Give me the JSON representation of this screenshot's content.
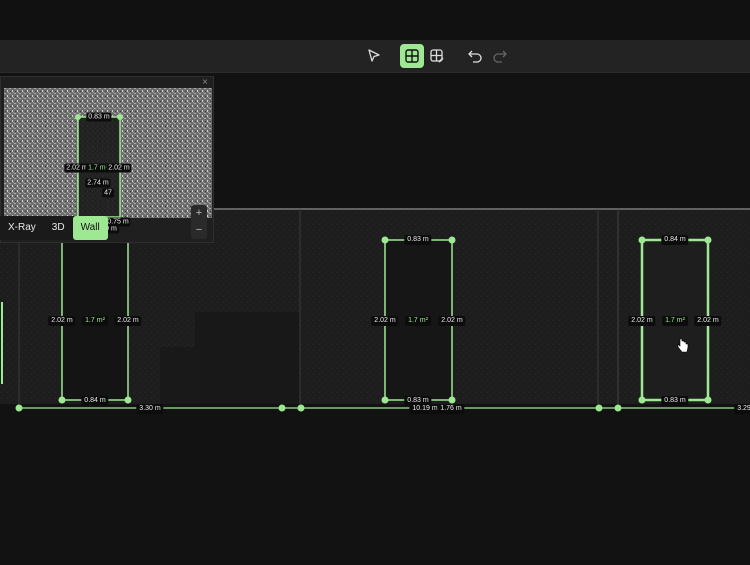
{
  "colors": {
    "accent": "#9ee893",
    "toolbar_bg": "#232323",
    "canvas_bg": "#121212"
  },
  "toolbar": {
    "tools": [
      {
        "name": "select-tool",
        "icon": "cursor-arrow-icon",
        "active": false
      },
      {
        "name": "add-opening-tool",
        "icon": "grid-plus-icon",
        "active": true
      },
      {
        "name": "edit-opening-tool",
        "icon": "grid-edit-icon",
        "active": false
      },
      {
        "name": "undo",
        "icon": "undo-icon",
        "active": false
      },
      {
        "name": "redo",
        "icon": "redo-icon",
        "active": false
      }
    ]
  },
  "minimap": {
    "close": "×",
    "labels": {
      "top_width": "0.83 m",
      "left_height": "2.02 m",
      "area": "1.7 m²",
      "right_height": "2.02 m",
      "wall_height": "2.74 m",
      "partial": "47",
      "bottom_a": "0.75 m",
      "bottom_b": "19 m"
    },
    "zoom_in": "+",
    "zoom_out": "−"
  },
  "view_tabs": [
    {
      "label": "X-Ray",
      "active": false
    },
    {
      "label": "3D",
      "active": false
    },
    {
      "label": "Wall",
      "active": true
    }
  ],
  "openings": [
    {
      "id": "opening-1",
      "width_top": "",
      "width_bottom": "0.84 m",
      "height_left": "2.02 m",
      "area": "1.7 m²",
      "height_right": "2.02 m"
    },
    {
      "id": "opening-2",
      "width_top": "0.83 m",
      "width_bottom": "0.83 m",
      "height_left": "2.02 m",
      "area": "1.7 m²",
      "height_right": "2.02 m"
    },
    {
      "id": "opening-3",
      "width_top": "0.84 m",
      "width_bottom": "0.83 m",
      "height_left": "2.02 m",
      "area": "1.7 m²",
      "height_right": "2.02 m"
    }
  ],
  "wall_dimensions": {
    "segment_left": "3.30 m",
    "segment_total": "10.19 m",
    "segment_mid": "1.76 m",
    "segment_right": "3.29"
  }
}
